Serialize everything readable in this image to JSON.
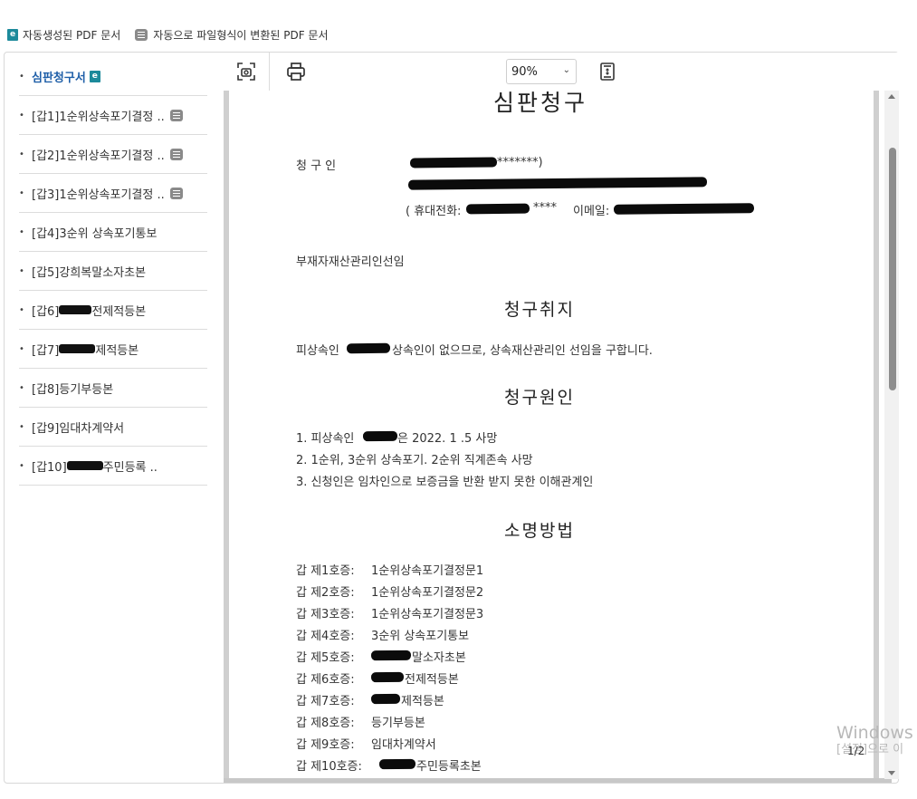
{
  "legend": {
    "auto_icon": "e",
    "auto_label": "자동생성된 PDF 문서",
    "conv_label": "자동으로 파일형식이 변환된 PDF 문서"
  },
  "sidebar": {
    "items": [
      {
        "label": "심판청구서",
        "tag": "auto",
        "active": true
      },
      {
        "label": "[갑1]1순위상속포기결정 ..",
        "tag": "conv"
      },
      {
        "label": "[갑2]1순위상속포기결정 ..",
        "tag": "conv"
      },
      {
        "label": "[갑3]1순위상속포기결정 ..",
        "tag": "conv"
      },
      {
        "label": "[갑4]3순위 상속포기통보",
        "tag": ""
      },
      {
        "label": "[갑5]강희복말소자초본",
        "tag": ""
      },
      {
        "label_pre": "[갑6]",
        "label_post": "전제적등본",
        "tag": ""
      },
      {
        "label_pre": "[갑7]",
        "label_post": "제적등본",
        "tag": ""
      },
      {
        "label": "[갑8]등기부등본",
        "tag": ""
      },
      {
        "label": "[갑9]임대차계약서",
        "tag": ""
      },
      {
        "label_pre": "[갑10]",
        "label_post": "주민등록 ..",
        "tag": ""
      }
    ]
  },
  "toolbar": {
    "capture_icon": "screenshot-capture-icon",
    "print_icon": "printer-icon",
    "zoom_value": "90%",
    "fit_icon": "fit-page-icon"
  },
  "document": {
    "title": "심판청구",
    "claimant_label": "청   구   인",
    "claimant_suffix": "*******)",
    "phone_prefix": "( 휴대전화:",
    "phone_suffix": "****",
    "email_label": "이메일:",
    "subject": "부재자재산관리인선임",
    "sec1_title": "청구취지",
    "sec1_body_pre": "피상속인",
    "sec1_body_post": "상속인이 없으므로, 상속재산관리인 선임을 구합니다.",
    "sec2_title": "청구원인",
    "cause1_pre": "1. 피상속인",
    "cause1_post": "은 2022. 1 .5 사망",
    "cause2": "2. 1순위, 3순위 상속포기. 2순위 직계존속 사망",
    "cause3": "3. 신청인은 임차인으로 보증금을 반환 받지 못한 이해관계인",
    "sec3_title": "소명방법",
    "evidence": [
      {
        "no": "갑 제1호증:",
        "desc": "1순위상속포기결정문1"
      },
      {
        "no": "갑 제2호증:",
        "desc": "1순위상속포기결정문2"
      },
      {
        "no": "갑 제3호증:",
        "desc": "1순위상속포기결정문3"
      },
      {
        "no": "갑 제4호증:",
        "desc": "3순위 상속포기통보"
      },
      {
        "no": "갑 제5호증:",
        "desc": "말소자초본",
        "redacted": true
      },
      {
        "no": "갑 제6호증:",
        "desc": "전제적등본",
        "redacted": true
      },
      {
        "no": "갑 제7호증:",
        "desc": "제적등본",
        "redacted": true
      },
      {
        "no": "갑 제8호증:",
        "desc": "등기부등본"
      },
      {
        "no": "갑 제9호증:",
        "desc": "임대차계약서"
      },
      {
        "no": "갑 제10호증:",
        "desc": "주민등록초본",
        "redacted": true
      }
    ]
  },
  "page_indicator": "1/2",
  "watermark": {
    "line1": "Windows",
    "line2": "[설정]으로 이"
  },
  "colors": {
    "accent": "#1f5fa8",
    "auto_tag": "#1c8a9b",
    "conv_tag": "#8a8a8a"
  }
}
